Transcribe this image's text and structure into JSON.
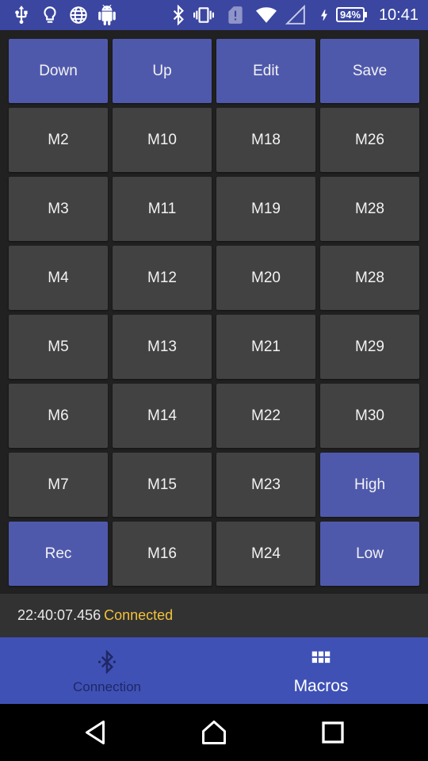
{
  "statusbar": {
    "battery": "94%",
    "time": "10:41",
    "icons": [
      "usb-icon",
      "lightbulb-icon",
      "globe-icon",
      "android-icon",
      "bluetooth-icon",
      "vibrate-icon",
      "sim-alert-icon",
      "wifi-icon",
      "signal-icon",
      "charging-icon"
    ]
  },
  "grid": {
    "rows": [
      [
        "Down",
        "Up",
        "Edit",
        "Save"
      ],
      [
        "M2",
        "M10",
        "M18",
        "M26"
      ],
      [
        "M3",
        "M11",
        "M19",
        "M28"
      ],
      [
        "M4",
        "M12",
        "M20",
        "M28"
      ],
      [
        "M5",
        "M13",
        "M21",
        "M29"
      ],
      [
        "M6",
        "M14",
        "M22",
        "M30"
      ],
      [
        "M7",
        "M15",
        "M23",
        "High"
      ],
      [
        "Rec",
        "M16",
        "M24",
        "Low"
      ]
    ]
  },
  "log": {
    "timestamp": "22:40:07.456",
    "status": "Connected"
  },
  "bottomnav": {
    "tabs": [
      {
        "label": "Connection",
        "icon": "bluetooth-icon"
      },
      {
        "label": "Macros",
        "icon": "grid-icon"
      }
    ]
  },
  "colors": {
    "accent_key": "#4f59ac",
    "key": "#424242",
    "status_connected": "#f2c23a",
    "nav_bg": "#3f51b5"
  }
}
